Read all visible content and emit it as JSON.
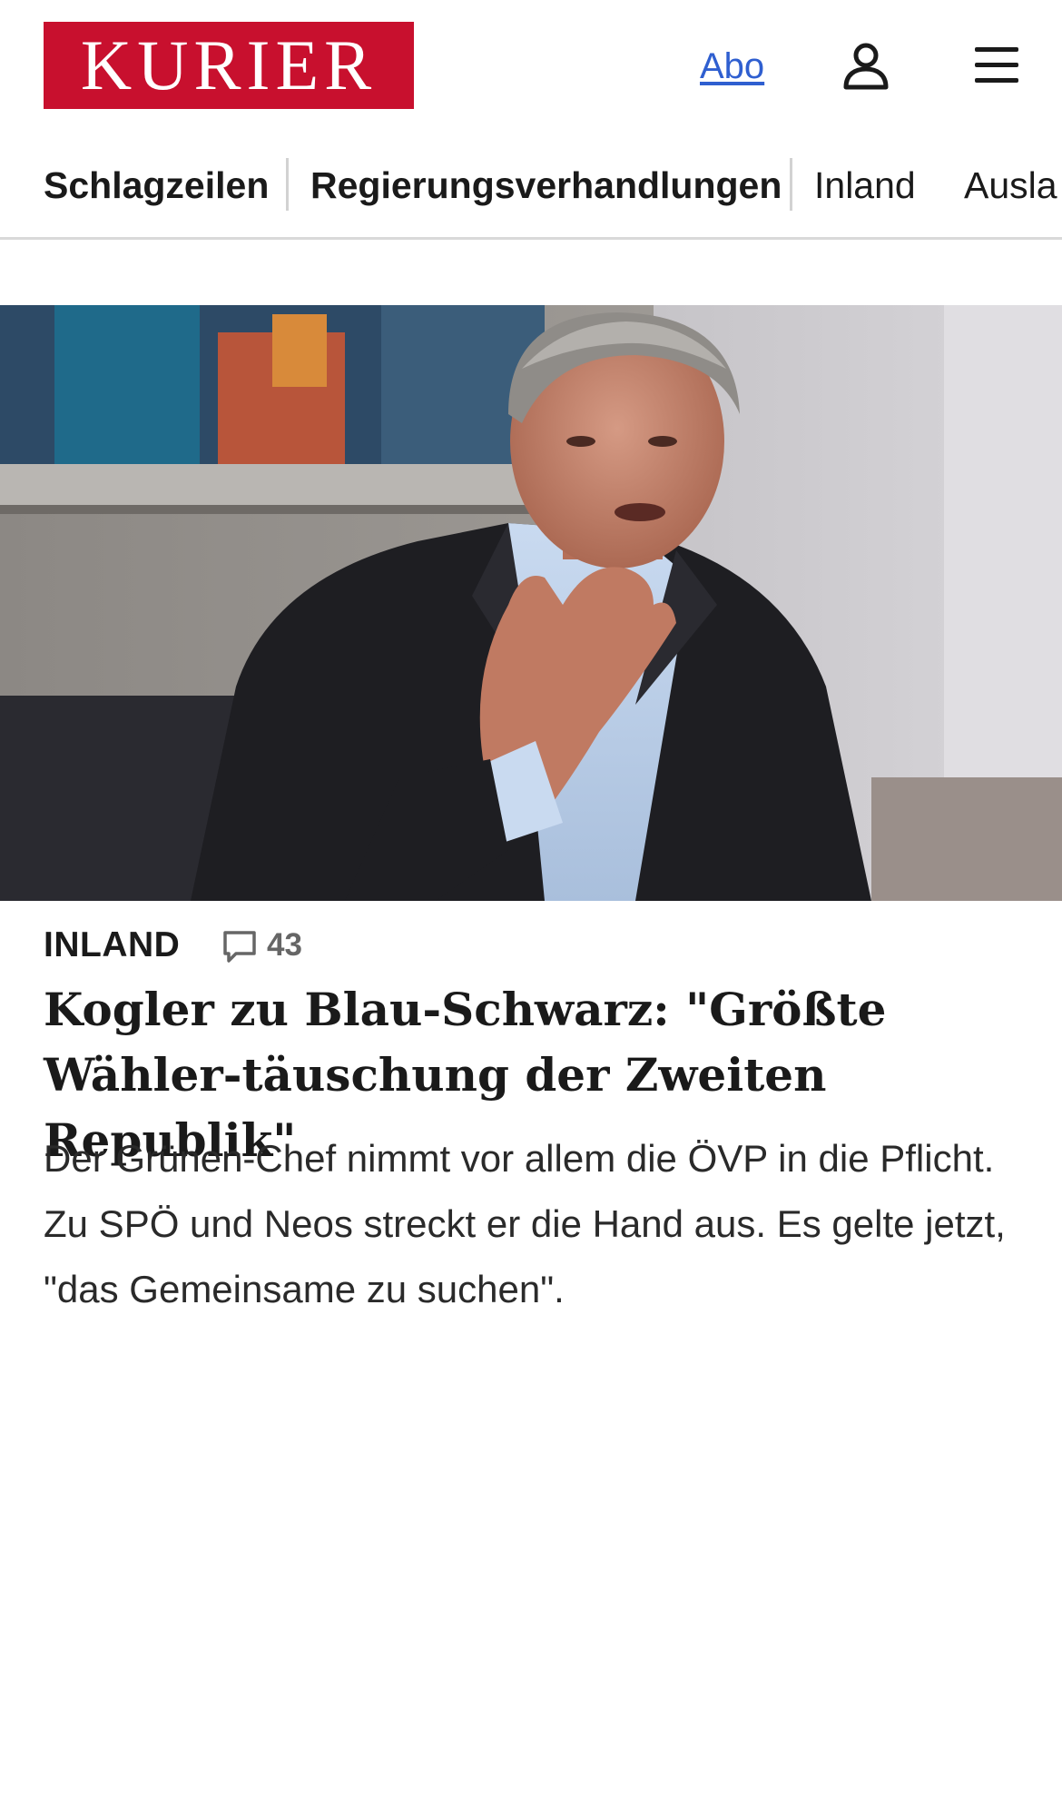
{
  "brand": {
    "logo_text": "KURIER",
    "brand_color": "#c8102e"
  },
  "header": {
    "abo_label": "Abo",
    "user_icon": "user-icon",
    "menu_icon": "hamburger-menu-icon",
    "link_color": "#2f5fd0"
  },
  "nav": {
    "items": [
      {
        "label": "Schlagzeilen"
      },
      {
        "label": "Regierungsverhandlungen"
      },
      {
        "label": "Inland"
      },
      {
        "label": "Ausla"
      }
    ]
  },
  "article": {
    "category": "INLAND",
    "comment_icon": "speech-bubble-icon",
    "comment_count": "43",
    "headline": "Kogler zu Blau-Schwarz: \"Größte Wähler-täuschung der Zweiten Republik\"",
    "teaser": "Der Grünen-Chef nimmt vor allem die ÖVP in die Pflicht. Zu SPÖ und Neos streckt er die Hand aus. Es gelte jetzt, \"das Gemeinsame zu suchen\"."
  }
}
